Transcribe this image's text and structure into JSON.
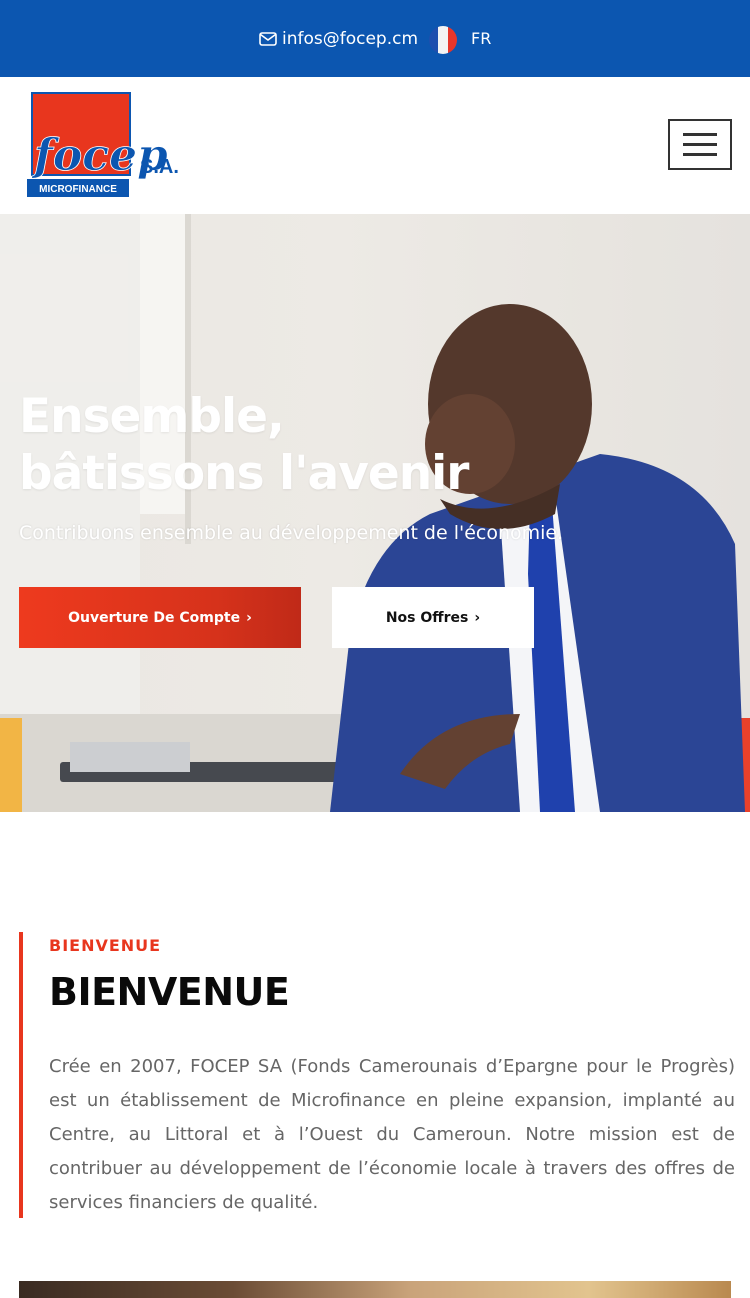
{
  "topbar": {
    "email": "infos@focep.cm",
    "language": "FR",
    "background_color": "#0c56b0"
  },
  "header": {
    "logo": {
      "brand": "focep",
      "suffix": "S.A.",
      "tagline": "MICROFINANCE"
    },
    "menu_icon": "hamburger-icon"
  },
  "hero": {
    "title_line1": "Ensemble,",
    "title_line2": "bâtissons l'avenir",
    "subtitle": "Contribuons ensemble au développement de l'économie.",
    "primary_button": "Ouverture De Compte",
    "secondary_button": "Nos Offres",
    "accent_color": "#e8361e"
  },
  "welcome": {
    "kicker": "BIENVENUE",
    "heading": "BIENVENUE",
    "body": "Crée en 2007, FOCEP SA (Fonds Camerounais d’Epargne pour le Progrès) est un établissement de Microfinance en pleine expansion, implanté au Centre, au Littoral et à l’Ouest du Cameroun. Notre mission est de contribuer au développement de l’économie locale à travers des offres de services financiers de qualité."
  }
}
